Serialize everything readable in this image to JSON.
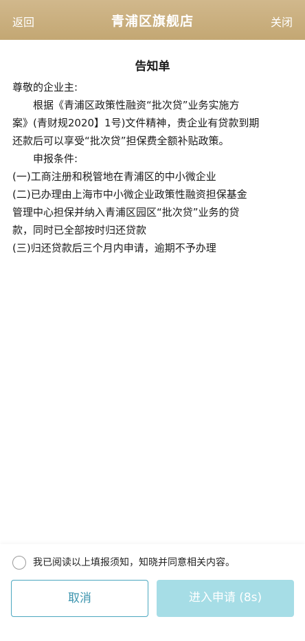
{
  "header": {
    "back": "返回",
    "title": "青浦区旗舰店",
    "close": "关闭"
  },
  "document": {
    "title": "告知单",
    "lines": [
      "尊敬的企业主:",
      "根据《青浦区政策性融资“批次贷”业务实施方",
      "案》(青财规2020】1号)文件精神，贵企业有贷款到期",
      "还款后可以享受“批次贷”担保费全额补贴政策。",
      "申报条件:",
      "(一)工商注册和税管地在青浦区的中小微企业",
      "(二)已办理由上海市中小微企业政策性融资担保基金",
      "管理中心担保并纳入青浦区园区“批次贷”业务的贷",
      "款，同时已全部按时归还贷款",
      "(三)归还贷款后三个月内申请，逾期不予办理"
    ]
  },
  "footer": {
    "agree_text": "我已阅读以上填报须知，知晓并同意相关内容。",
    "cancel_label": "取消",
    "apply_label": "进入申请 (8s)"
  }
}
